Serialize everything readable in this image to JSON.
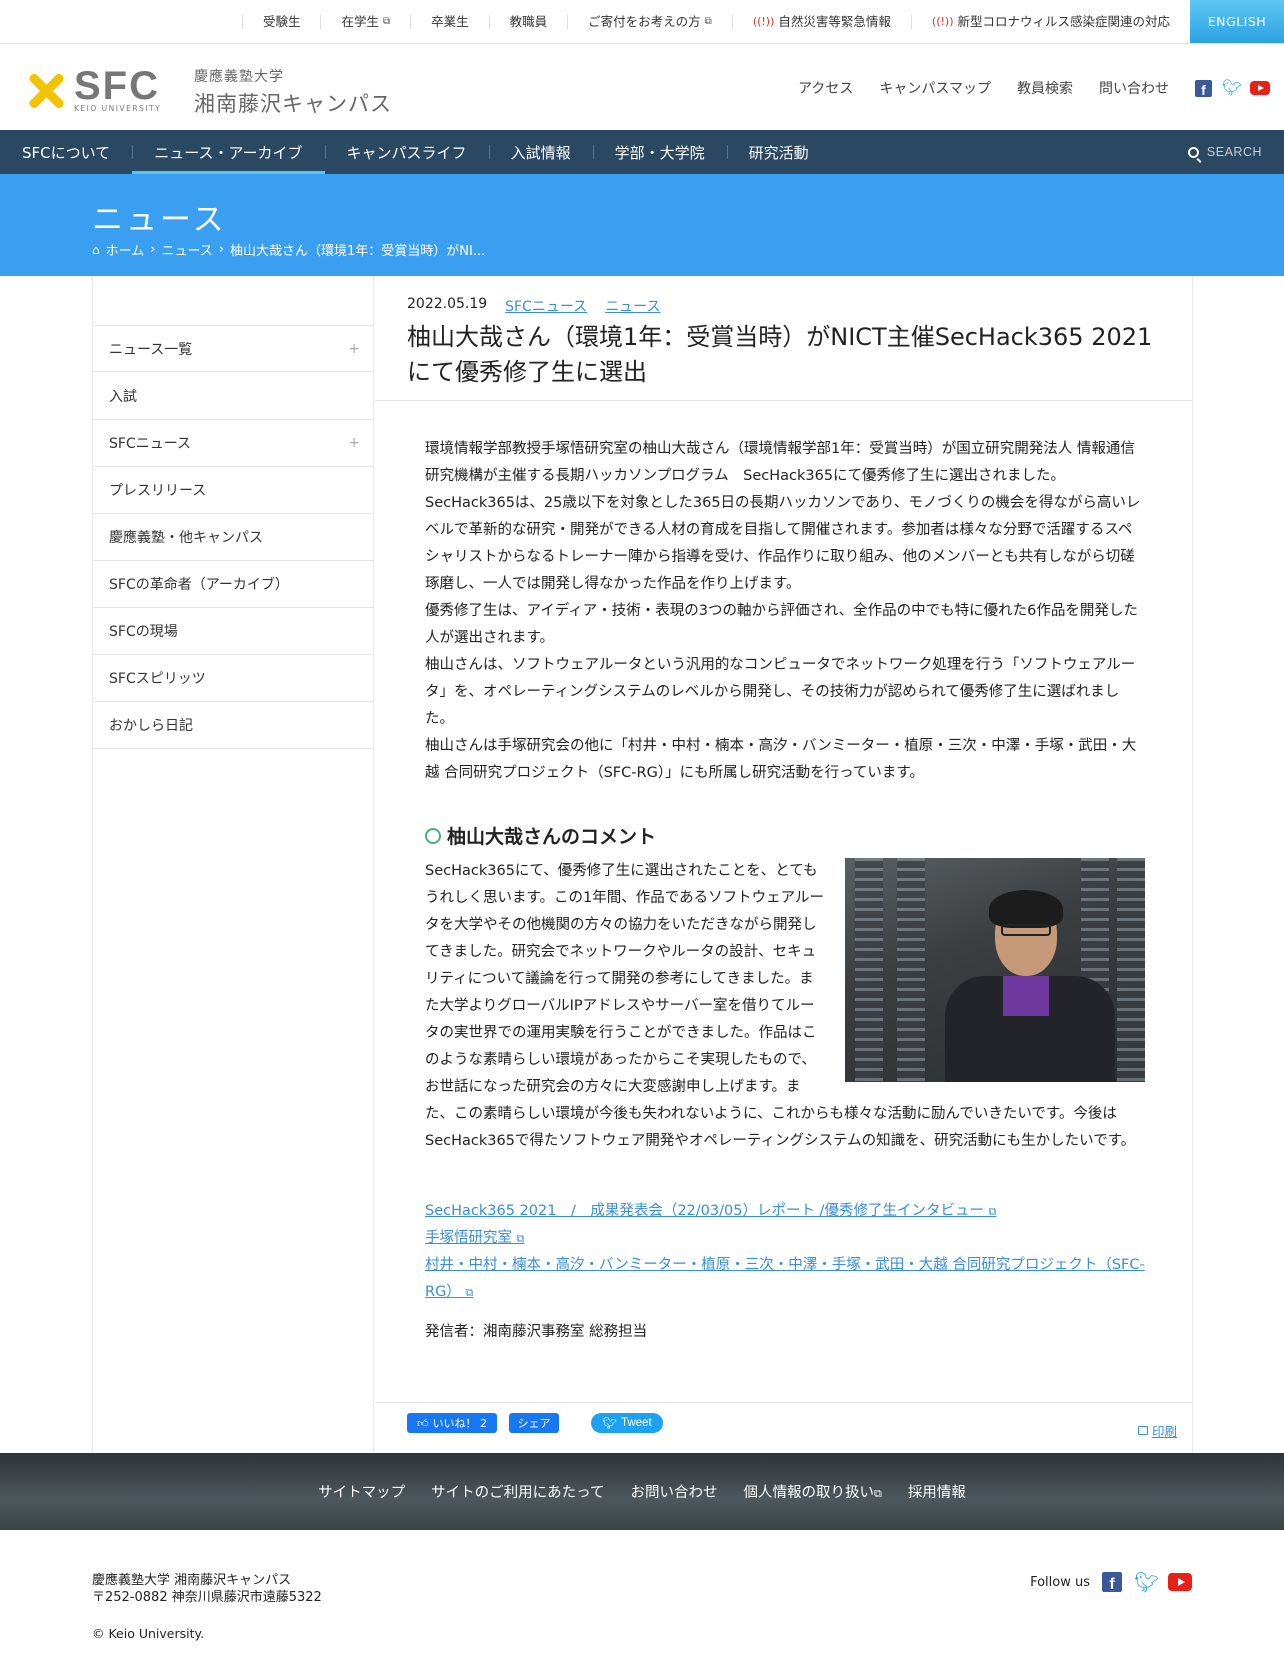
{
  "topbar": {
    "links": [
      "受験生",
      "在学生",
      "卒業生",
      "教職員",
      "ご寄付をお考えの方",
      "自然災害等緊急情報",
      "新型コロナウィルス感染症関連の対応"
    ],
    "english": "ENGLISH"
  },
  "header": {
    "logo_sfc": "SFC",
    "logo_keio": "KEIO UNIVERSITY",
    "logo_ja_1": "慶應義塾大学",
    "logo_ja_2": "湘南藤沢キャンパス",
    "links": [
      "アクセス",
      "キャンパスマップ",
      "教員検索",
      "問い合わせ"
    ]
  },
  "nav": {
    "items": [
      "SFCについて",
      "ニュース・アーカイブ",
      "キャンパスライフ",
      "入試情報",
      "学部・大学院",
      "研究活動"
    ],
    "active_index": 1,
    "search": "SEARCH"
  },
  "banner": {
    "title": "ニュース",
    "breadcrumb": [
      "ホーム",
      "ニュース",
      "柚山大哉さん（環境1年：受賞当時）がNI..."
    ]
  },
  "sidebar": {
    "items": [
      "ニュース一覧",
      "入試",
      "SFCニュース",
      "プレスリリース",
      "慶應義塾・他キャンパス",
      "SFCの革命者（アーカイブ）",
      "SFCの現場",
      "SFCスピリッツ",
      "おかしら日記"
    ]
  },
  "post": {
    "date": "2022.05.19",
    "categories": [
      "SFCニュース",
      "ニュース"
    ],
    "title": "柚山大哉さん（環境1年：受賞当時）がNICT主催SecHack365 2021にて優秀修了生に選出",
    "paragraphs": [
      "環境情報学部教授手塚悟研究室の柚山大哉さん（環境情報学部1年：受賞当時）が国立研究開発法人 情報通信研究機構が主催する長期ハッカソンプログラム　SecHack365にて優秀修了生に選出されました。",
      "SecHack365は、25歳以下を対象とした365日の長期ハッカソンであり、モノづくりの機会を得ながら高いレベルで革新的な研究・開発ができる人材の育成を目指して開催されます。参加者は様々な分野で活躍するスペシャリストからなるトレーナー陣から指導を受け、作品作りに取り組み、他のメンバーとも共有しながら切磋琢磨し、一人では開発し得なかった作品を作り上げます。",
      "優秀修了生は、アイディア・技術・表現の3つの軸から評価され、全作品の中でも特に優れた6作品を開発した人が選出されます。",
      "柚山さんは、ソフトウェアルータという汎用的なコンピュータでネットワーク処理を行う「ソフトウェアルータ」を、オペレーティングシステムのレベルから開発し、その技術力が認められて優秀修了生に選ばれました。",
      "柚山さんは手塚研究会の他に「村井・中村・楠本・高汐・バンミーター・植原・三次・中澤・手塚・武田・大越 合同研究プロジェクト（SFC-RG）」にも所属し研究活動を行っています。"
    ],
    "comment_heading": "柚山大哉さんのコメント",
    "comment": "SecHack365にて、優秀修了生に選出されたことを、とてもうれしく思います。この1年間、作品であるソフトウェアルータを大学やその他機関の方々の協力をいただきながら開発してきました。研究会でネットワークやルータの設計、セキュリティについて議論を行って開発の参考にしてきました。また大学よりグローバルIPアドレスやサーバー室を借りてルータの実世界での運用実験を行うことができました。作品はこのような素晴らしい環境があったからこそ実現したもので、お世話になった研究会の方々に大変感謝申し上げます。また、この素晴らしい環境が今後も失われないように、これからも様々な活動に励んでいきたいです。今後はSecHack365で得たソフトウェア開発やオペレーティングシステムの知識を、研究活動にも生かしたいです。",
    "links": [
      "SecHack365 2021　/　成果発表会（22/03/05）レポート /優秀修了生インタビュー",
      "手塚悟研究室",
      "村井・中村・楠本・高汐・バンミーター・植原・三次・中澤・手塚・武田・大越 合同研究プロジェクト（SFC-RG）"
    ],
    "sender": "発信者：湘南藤沢事務室 総務担当"
  },
  "share": {
    "like": "いいね！ 2",
    "share": "シェア",
    "tweet": "Tweet",
    "print": "印刷"
  },
  "footer": {
    "nav": [
      "サイトマップ",
      "サイトのご利用にあたって",
      "お問い合わせ",
      "個人情報の取り扱い",
      "採用情報"
    ],
    "name": "慶應義塾大学 湘南藤沢キャンパス",
    "address": "〒252-0882 神奈川県藤沢市遠藤5322",
    "copyright": "© Keio University.",
    "follow": "Follow us"
  }
}
